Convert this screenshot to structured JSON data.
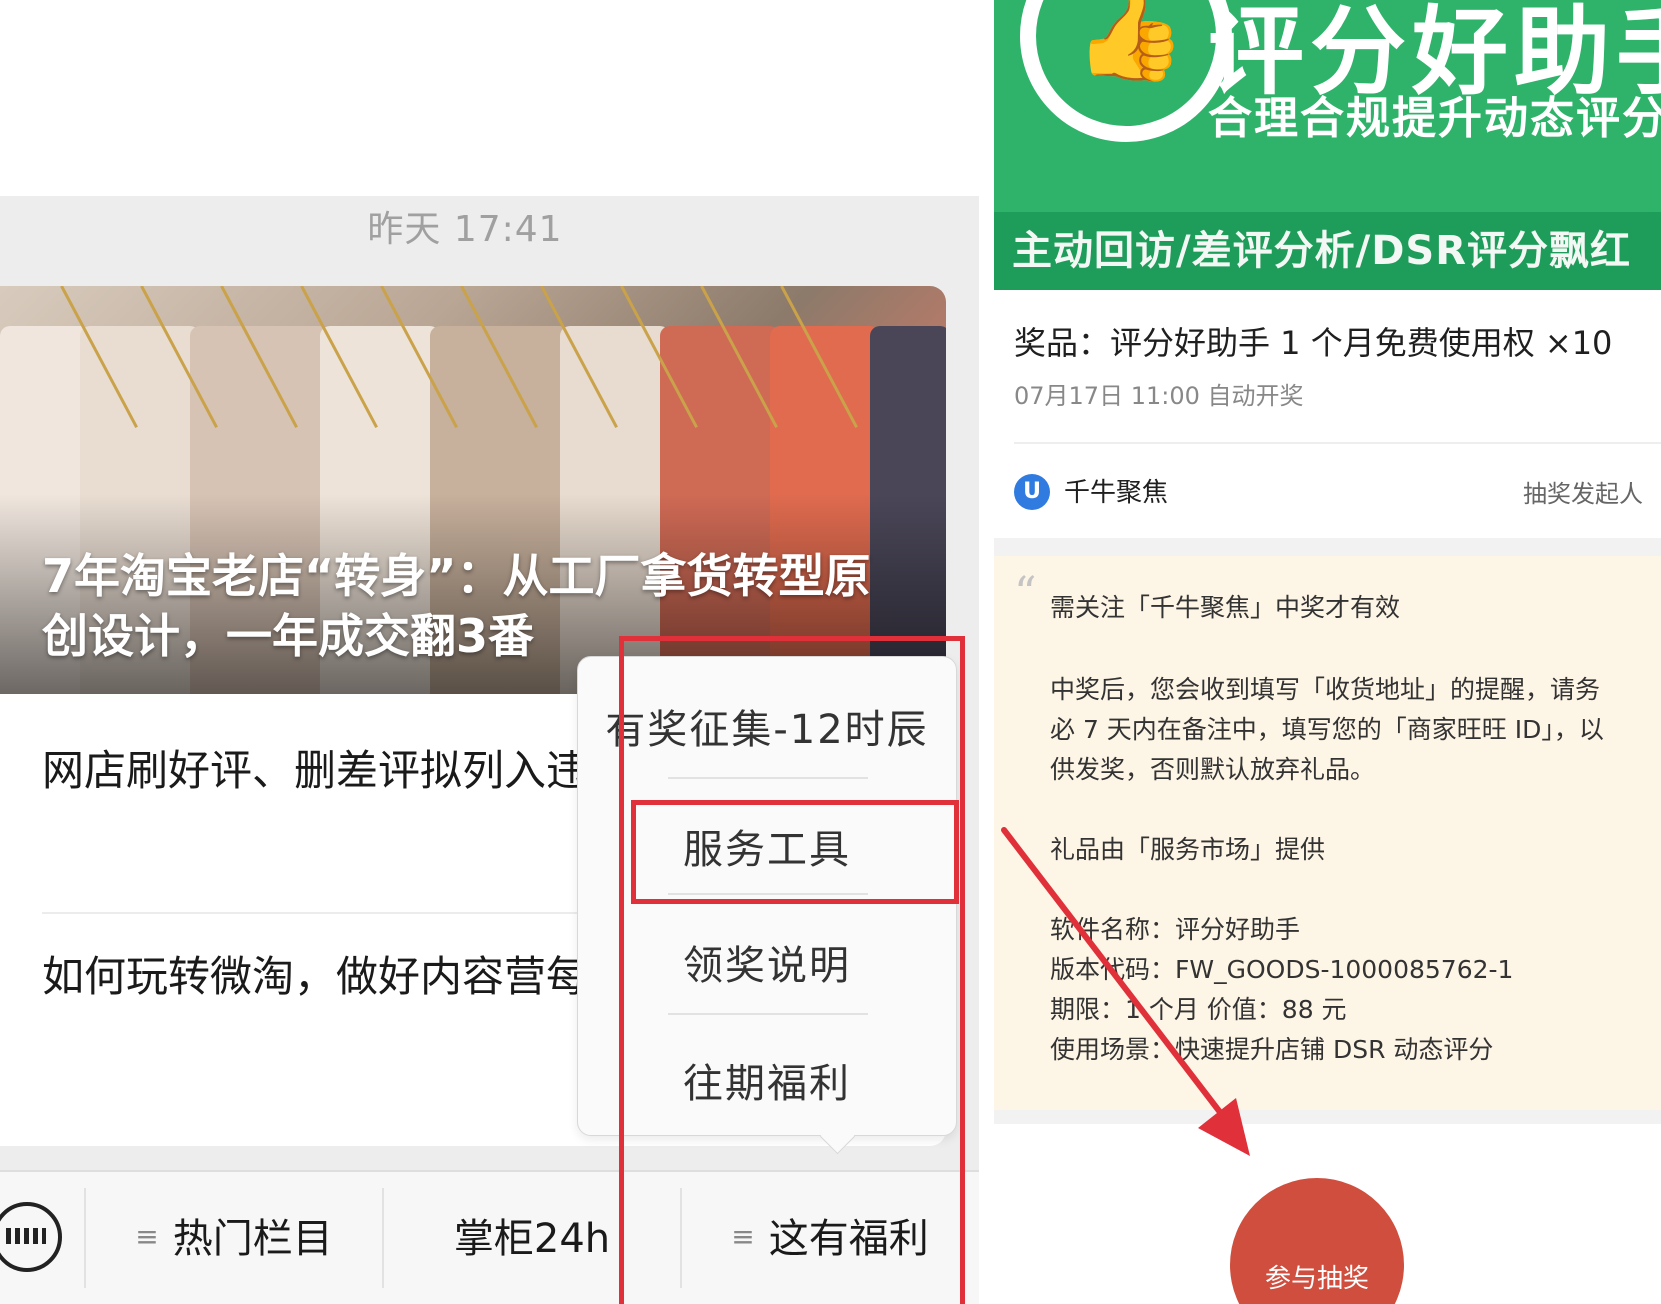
{
  "left": {
    "timestamp": "昨天 17:41",
    "hero_title": "7年淘宝老店“转身”：从工厂拿货转型原创设计，一年成交翻3番",
    "articles": [
      {
        "title": "网店刷好评、删差评拟列入违法失信名单"
      },
      {
        "title": "如何玩转微淘，做好内容营每日一课"
      }
    ],
    "popup_menu": {
      "items": [
        {
          "label": "有奖征集-12时辰"
        },
        {
          "label": "服务工具"
        },
        {
          "label": "领奖说明"
        },
        {
          "label": "往期福利"
        }
      ]
    },
    "bottom_bar": {
      "items": [
        {
          "label": "热门栏目",
          "icon": "menu-lines-icon"
        },
        {
          "label": "掌柜24h"
        },
        {
          "label": "这有福利",
          "icon": "menu-lines-icon"
        }
      ],
      "menu_glyph": "≡"
    }
  },
  "right": {
    "banner": {
      "title": "评分好助手",
      "subtitle": "合理合规提升动态评分",
      "strip": "主动回访/差评分析/DSR评分飘红",
      "color": "#2fb36b"
    },
    "prize": "奖品：评分好助手 1 个月免费使用权 ×10",
    "draw_time": "07月17日 11:00 自动开奖",
    "organizer": {
      "name": "千牛聚焦",
      "role": "抽奖发起人"
    },
    "notes": [
      "需关注「千牛聚焦」中奖才有效",
      "中奖后，您会收到填写「收货地址」的提醒，请务",
      "必 7 天内在备注中，填写您的「商家旺旺 ID」，以",
      "供发奖，否则默认放弃礼品。",
      "礼品由「服务市场」提供",
      "软件名称：评分好助手",
      "版本代码：FW_GOODS-1000085762-1",
      "期限：1 个月  价值：88 元",
      "使用场景：快速提升店铺 DSR 动态评分"
    ],
    "join_button": "参与抽奖"
  },
  "annotation_color": "#e0303a"
}
